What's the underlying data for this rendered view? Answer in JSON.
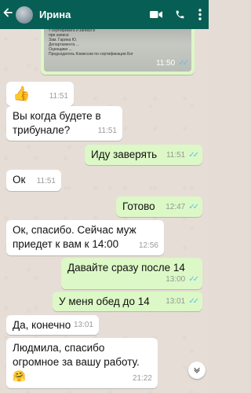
{
  "header": {
    "back_icon": "arrow-left-icon",
    "contact_name": "Ирина",
    "video_icon": "video-camera-icon",
    "call_icon": "phone-icon",
    "menu_icon": "more-vertical-icon",
    "bg_color": "#075e54"
  },
  "image_message": {
    "doc_lines": [
      "т сертификата и записи в",
      "при записи",
      "Зам.            Гарина Ю.",
      "Департамента ...",
      "Оценщики   ...",
      "Председатель Комиссии по сертификации   Бог"
    ],
    "time": "11:50",
    "status": "read"
  },
  "messages": [
    {
      "dir": "in",
      "text": "👍",
      "time": "11:51"
    },
    {
      "dir": "in",
      "text": "Вы когда будете в\nтрибунале?",
      "time": "11:51"
    },
    {
      "dir": "out",
      "text": "Иду заверять",
      "time": "11:51",
      "status": "read"
    },
    {
      "dir": "in",
      "text": "Ок",
      "time": "11:51"
    },
    {
      "dir": "out",
      "text": "Готово",
      "time": "12:47",
      "status": "read"
    },
    {
      "dir": "in",
      "text": "Ок, спасибо. Сейчас муж\nприедет к вам к 14:00",
      "time": "12:56"
    },
    {
      "dir": "out",
      "text": "Давайте сразу после 14",
      "time": "13:00",
      "status": "read"
    },
    {
      "dir": "out",
      "text": "У меня обед до 14",
      "time": "13:01",
      "status": "read"
    },
    {
      "dir": "in",
      "text": "Да, конечно",
      "time": "13:01"
    },
    {
      "dir": "in",
      "text": "Людмила, спасибо\nогромное за вашу работу.\n🤗",
      "time": "21:22"
    }
  ],
  "colors": {
    "incoming_bubble": "#ffffff",
    "outgoing_bubble": "#dcf8c6",
    "read_ticks": "#4fc3f7"
  },
  "scroll_down_icon": "chevron-down-icon"
}
